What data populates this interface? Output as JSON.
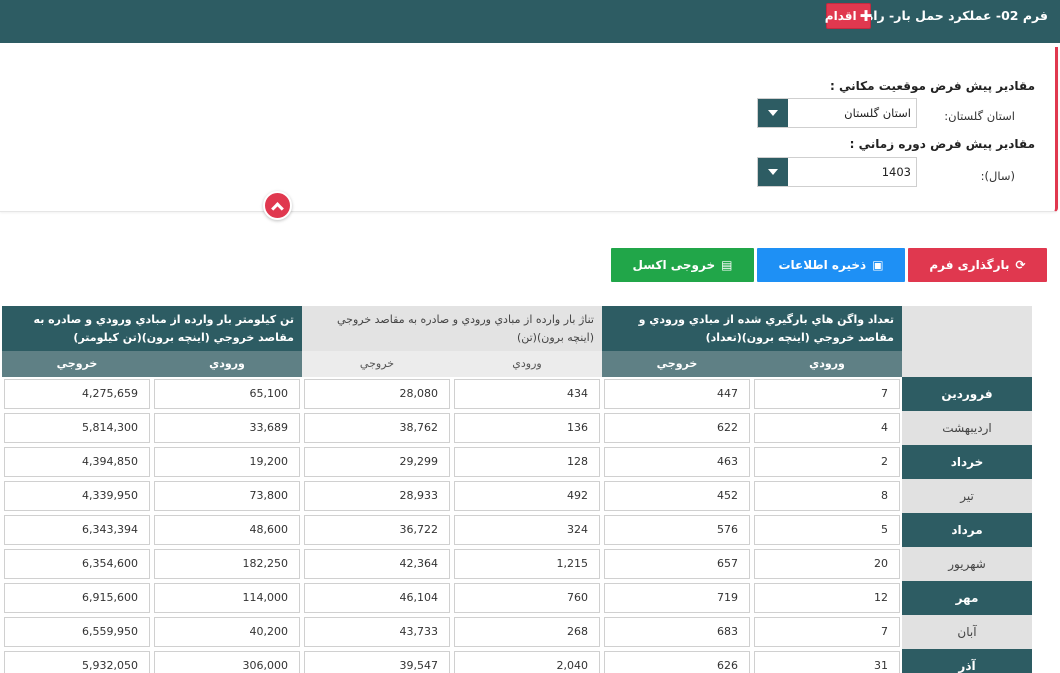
{
  "header": {
    "title": "فرم 02- عملکرد حمل بار- راه آهن",
    "actions_label": "اقدام",
    "actions_icon": "plus-icon"
  },
  "filters": {
    "location_heading": "مقادير پيش فرض موقعيت مکاني :",
    "location_label": "استان گلستان:",
    "location_value": "استان گلستان",
    "period_heading": "مقادير پيش فرض دوره زماني :",
    "period_label": "(سال):",
    "period_value": "1403"
  },
  "buttons": {
    "reload_label": "بارگذاری فرم",
    "save_label": "ذخيره اطلاعات",
    "excel_label": "خروجی اکسل"
  },
  "table": {
    "groups": [
      "تعداد واگن هاي بارگيري شده از مبادي ورودي و مقاصد خروجي (اينچه برون)(تعداد)",
      "تناژ بار وارده از مبادي ورودي و صادره به مقاصد خروجي (اينچه برون)(تن)",
      "تن کيلومتر بار وارده از مبادي ورودي و صادره به مقاصد خروجي (اينچه برون)(تن کيلومتر)"
    ],
    "sub_headers": [
      "ورودي",
      "خروجي"
    ],
    "rows": [
      {
        "month": "فروردين",
        "values": [
          "7",
          "447",
          "434",
          "28,080",
          "65,100",
          "4,275,659"
        ]
      },
      {
        "month": "ارديبهشت",
        "values": [
          "4",
          "622",
          "136",
          "38,762",
          "33,689",
          "5,814,300"
        ]
      },
      {
        "month": "خرداد",
        "values": [
          "2",
          "463",
          "128",
          "29,299",
          "19,200",
          "4,394,850"
        ]
      },
      {
        "month": "تير",
        "values": [
          "8",
          "452",
          "492",
          "28,933",
          "73,800",
          "4,339,950"
        ]
      },
      {
        "month": "مرداد",
        "values": [
          "5",
          "576",
          "324",
          "36,722",
          "48,600",
          "6,343,394"
        ]
      },
      {
        "month": "شهريور",
        "values": [
          "20",
          "657",
          "1,215",
          "42,364",
          "182,250",
          "6,354,600"
        ]
      },
      {
        "month": "مهر",
        "values": [
          "12",
          "719",
          "760",
          "46,104",
          "114,000",
          "6,915,600"
        ]
      },
      {
        "month": "آبان",
        "values": [
          "7",
          "683",
          "268",
          "43,733",
          "40,200",
          "6,559,950"
        ]
      },
      {
        "month": "آذر",
        "values": [
          "31",
          "626",
          "2,040",
          "39,547",
          "306,000",
          "5,932,050"
        ]
      }
    ]
  }
}
